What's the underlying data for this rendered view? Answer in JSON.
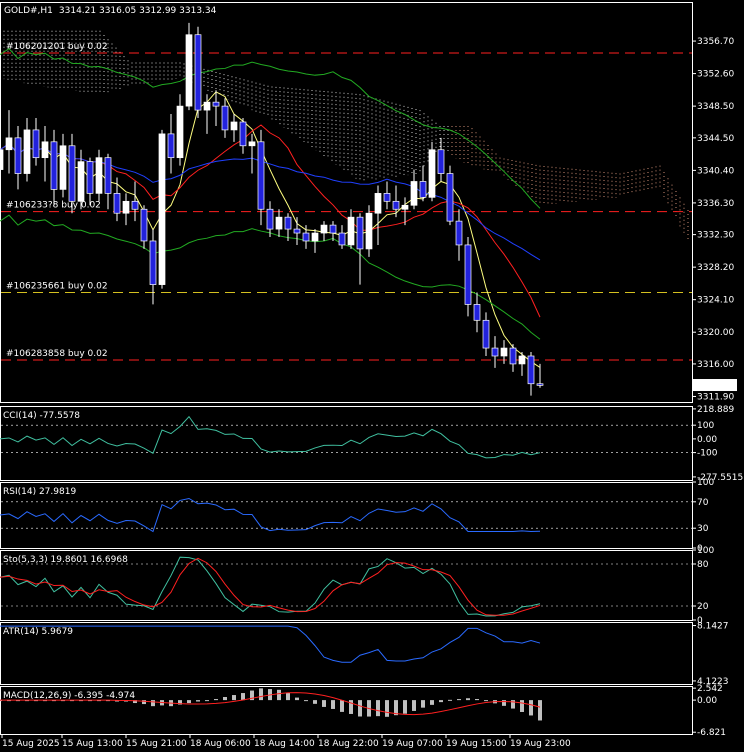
{
  "header": {
    "symbol": "GOLD#,H1",
    "ohlc": "3314.21 3316.05 3312.99 3313.34"
  },
  "colors": {
    "bull": "#ffffff",
    "bear": "#1010d0",
    "bear_body": "#2222dd",
    "wick": "#ffffff",
    "red": "#ff2020",
    "yellow": "#ffff80",
    "green": "#22aa22",
    "blue": "#2040ff",
    "cloud": "#ffffff",
    "grid": "#ffffff",
    "cci": "#40c0a0",
    "rsi": "#2a6aff",
    "stoch_main": "#40c0a0",
    "stoch_signal": "#ff2020",
    "atr": "#2a6aff",
    "macd_hist": "#c0c0c0"
  },
  "orders": [
    {
      "label": "#106201201 buy 0.02",
      "price": 3355.2,
      "color": "#ff2020"
    },
    {
      "label": "#106233?8 buy 0.02",
      "price": 3335.2,
      "color": "#ff2020"
    },
    {
      "label": "#106235661 buy 0.02",
      "price": 3325.0,
      "color": "#d4c020"
    },
    {
      "label": "#106283858 buy 0.02",
      "price": 3316.5,
      "color": "#ff2020"
    }
  ],
  "price_axis": {
    "ticks": [
      "3356.70",
      "3352.60",
      "3348.50",
      "3344.50",
      "3340.40",
      "3336.30",
      "3332.30",
      "3328.20",
      "3324.10",
      "3320.00",
      "3316.00",
      "3311.90"
    ],
    "current": "3313.34"
  },
  "time_axis": {
    "labels": [
      "15 Aug 2025",
      "15 Aug 13:00",
      "15 Aug 21:00",
      "18 Aug 06:00",
      "18 Aug 14:00",
      "18 Aug 22:00",
      "19 Aug 07:00",
      "19 Aug 15:00",
      "19 Aug 23:00"
    ]
  },
  "panels": {
    "cci": {
      "title": "CCI(14) -77.5578",
      "ticks": [
        "218.889",
        "100",
        "0.00",
        "-100",
        "-277.5515"
      ]
    },
    "rsi": {
      "title": "RSI(14) 27.9819",
      "ticks": [
        "100",
        "70",
        "30",
        "0"
      ]
    },
    "stoch": {
      "title": "Sto(5,3,3) 19.8601 16.6968",
      "ticks": [
        "100",
        "80",
        "20",
        "0"
      ]
    },
    "atr": {
      "title": "ATR(14) 5.9679",
      "ticks": [
        "8.1427",
        "4.1223"
      ]
    },
    "macd": {
      "title": "MACD(12,26,9) -6.395 -4.974",
      "ticks": [
        "2.542",
        "0.00",
        "-6.821"
      ]
    }
  },
  "chart_data": {
    "type": "candlestick",
    "title": "GOLD#,H1",
    "ylim": [
      3311.2,
      3361.5
    ],
    "candles": [
      [
        3340.5,
        3346.5,
        3337.5,
        3343.0
      ],
      [
        3343.0,
        3348.0,
        3340.0,
        3344.5
      ],
      [
        3344.5,
        3346.0,
        3338.0,
        3340.0
      ],
      [
        3340.0,
        3347.0,
        3339.0,
        3345.5
      ],
      [
        3345.5,
        3347.0,
        3341.0,
        3342.0
      ],
      [
        3342.0,
        3346.0,
        3339.0,
        3344.0
      ],
      [
        3344.0,
        3345.5,
        3336.0,
        3338.0
      ],
      [
        3338.0,
        3345.0,
        3337.0,
        3343.5
      ],
      [
        3343.5,
        3345.0,
        3335.0,
        3336.5
      ],
      [
        3336.5,
        3343.0,
        3335.5,
        3341.5
      ],
      [
        3341.5,
        3342.0,
        3336.0,
        3337.5
      ],
      [
        3337.5,
        3343.0,
        3336.5,
        3342.0
      ],
      [
        3342.0,
        3342.5,
        3335.5,
        3337.5
      ],
      [
        3337.5,
        3339.5,
        3334.0,
        3335.0
      ],
      [
        3335.0,
        3337.5,
        3333.5,
        3336.5
      ],
      [
        3336.5,
        3339.0,
        3334.0,
        3335.5
      ],
      [
        3335.5,
        3336.0,
        3330.5,
        3331.5
      ],
      [
        3331.5,
        3333.0,
        3323.5,
        3326.0
      ],
      [
        3326.0,
        3345.5,
        3325.5,
        3345.0
      ],
      [
        3345.0,
        3347.5,
        3340.0,
        3342.0
      ],
      [
        3342.0,
        3350.0,
        3341.0,
        3348.5
      ],
      [
        3348.5,
        3359.0,
        3348.0,
        3357.5
      ],
      [
        3357.5,
        3358.5,
        3347.0,
        3348.0
      ],
      [
        3348.0,
        3350.0,
        3345.0,
        3349.0
      ],
      [
        3349.0,
        3350.5,
        3346.0,
        3348.5
      ],
      [
        3348.5,
        3349.5,
        3344.5,
        3345.5
      ],
      [
        3345.5,
        3347.5,
        3344.0,
        3346.5
      ],
      [
        3346.5,
        3347.0,
        3342.5,
        3343.5
      ],
      [
        3343.5,
        3345.0,
        3340.0,
        3344.0
      ],
      [
        3344.0,
        3345.5,
        3333.5,
        3335.5
      ],
      [
        3335.5,
        3336.5,
        3332.0,
        3333.0
      ],
      [
        3333.0,
        3335.5,
        3332.0,
        3334.5
      ],
      [
        3334.5,
        3335.0,
        3331.5,
        3333.0
      ],
      [
        3333.0,
        3334.5,
        3331.0,
        3332.5
      ],
      [
        3332.5,
        3333.5,
        3330.5,
        3331.5
      ],
      [
        3331.5,
        3333.0,
        3330.0,
        3332.5
      ],
      [
        3332.5,
        3334.0,
        3331.5,
        3333.5
      ],
      [
        3333.5,
        3334.0,
        3331.5,
        3332.5
      ],
      [
        3332.5,
        3333.5,
        3330.5,
        3331.0
      ],
      [
        3331.0,
        3335.5,
        3330.5,
        3334.5
      ],
      [
        3334.5,
        3335.0,
        3326.0,
        3330.5
      ],
      [
        3330.5,
        3336.0,
        3329.5,
        3335.0
      ],
      [
        3335.0,
        3338.5,
        3331.0,
        3337.5
      ],
      [
        3337.5,
        3339.0,
        3335.5,
        3336.5
      ],
      [
        3336.5,
        3338.5,
        3334.5,
        3335.5
      ],
      [
        3335.5,
        3337.0,
        3333.5,
        3336.0
      ],
      [
        3336.0,
        3340.5,
        3335.5,
        3339.0
      ],
      [
        3339.0,
        3341.0,
        3336.5,
        3337.0
      ],
      [
        3337.0,
        3344.0,
        3336.5,
        3343.0
      ],
      [
        3343.0,
        3344.5,
        3339.0,
        3340.0
      ],
      [
        3340.0,
        3341.0,
        3333.5,
        3334.0
      ],
      [
        3334.0,
        3335.5,
        3329.0,
        3331.0
      ],
      [
        3331.0,
        3332.0,
        3322.0,
        3323.5
      ],
      [
        3323.5,
        3325.0,
        3320.0,
        3321.5
      ],
      [
        3321.5,
        3322.5,
        3317.0,
        3318.0
      ],
      [
        3318.0,
        3319.5,
        3315.5,
        3317.0
      ],
      [
        3317.0,
        3319.0,
        3316.0,
        3318.0
      ],
      [
        3318.0,
        3318.5,
        3315.0,
        3316.0
      ],
      [
        3316.0,
        3317.5,
        3314.5,
        3317.0
      ],
      [
        3317.0,
        3317.5,
        3312.0,
        3313.5
      ],
      [
        3313.5,
        3316.0,
        3313.0,
        3313.3
      ]
    ],
    "indicator_panels": [
      "CCI(14)",
      "RSI(14)",
      "Sto(5,3,3)",
      "ATR(14)",
      "MACD(12,26,9)"
    ]
  }
}
